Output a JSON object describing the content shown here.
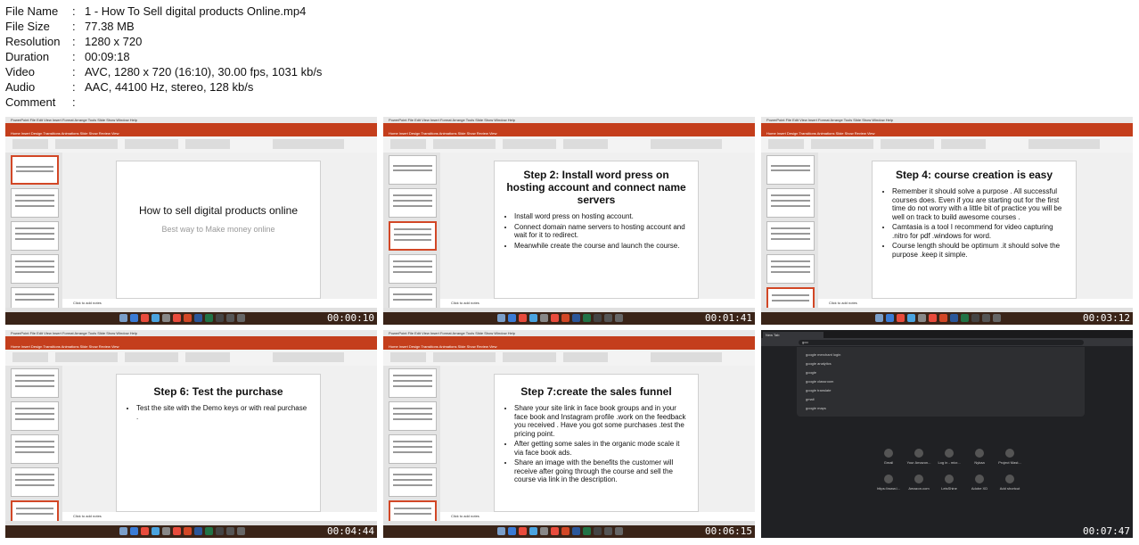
{
  "info": [
    {
      "key": "File Name",
      "value": "1 - How To Sell digital products Online.mp4"
    },
    {
      "key": "File Size",
      "value": "77.38 MB"
    },
    {
      "key": "Resolution",
      "value": "1280 x 720"
    },
    {
      "key": "Duration",
      "value": "00:09:18"
    },
    {
      "key": "Video",
      "value": "AVC, 1280 x 720 (16:10), 30.00 fps, 1031 kb/s"
    },
    {
      "key": "Audio",
      "value": "AAC, 44100 Hz, stereo, 128 kb/s"
    },
    {
      "key": "Comment",
      "value": ""
    }
  ],
  "separator": ":",
  "app": {
    "menubar": "PowerPoint   File   Edit   View   Insert   Format   Arrange   Tools   Slide Show   Window   Help",
    "tabs": "Home   Insert   Design   Transitions   Animations   Slide Show   Review   View",
    "notes": "Click to add notes"
  },
  "frames": [
    {
      "timestamp": "00:00:10",
      "slide": {
        "title": "How to sell digital products online",
        "subtitle": "Best way to Make money online"
      }
    },
    {
      "timestamp": "00:01:41",
      "slide": {
        "title": "Step 2: Install word press on hosting account and connect name servers",
        "bullets": [
          "Install word press on hosting account.",
          "Connect domain name servers to hosting account and wait for it to redirect.",
          "Meanwhile create the course and launch the course."
        ]
      }
    },
    {
      "timestamp": "00:03:12",
      "slide": {
        "title": "Step 4: course creation is easy",
        "bullets": [
          "Remember it should solve a purpose . All successful courses does. Even if you are starting out for the first time do not worry with a little bit of practice you will be well on track to build awesome courses .",
          "Camtasia is a tool I recommend for video capturing .nitro for pdf .windows for word.",
          "Course length should be optimum .it should solve the purpose .keep it simple."
        ]
      }
    },
    {
      "timestamp": "00:04:44",
      "slide": {
        "title": "Step 6: Test the purchase",
        "bullets": [
          "Test the site with the Demo keys or with real purchase ."
        ]
      }
    },
    {
      "timestamp": "00:06:15",
      "slide": {
        "title": "Step 7:create the sales funnel",
        "bullets": [
          "Share your site link in face book groups and in your face book and Instagram profile .work on the feedback you received . Have you got some purchases .test the pricing point.",
          "After getting some sales in the organic mode scale it via face book ads.",
          "Share an image with the benefits the customer will receive after going through the course and sell the course via link in the description."
        ]
      }
    },
    {
      "timestamp": "00:07:47",
      "browser": {
        "tab": "New Tab",
        "query": "goo",
        "suggestions": [
          "google merchant login",
          "google analytics",
          "google",
          "google classroom",
          "google translate",
          "gmail",
          "google maps"
        ],
        "shortcuts": [
          "Gmail",
          "Your Amazon...",
          "Log in - micr...",
          "Nykaa",
          "Project Mast...",
          "https://www.l...",
          "Amazon.com",
          "LetsShine",
          "Adobe XD",
          "Add shortcut"
        ]
      }
    }
  ]
}
